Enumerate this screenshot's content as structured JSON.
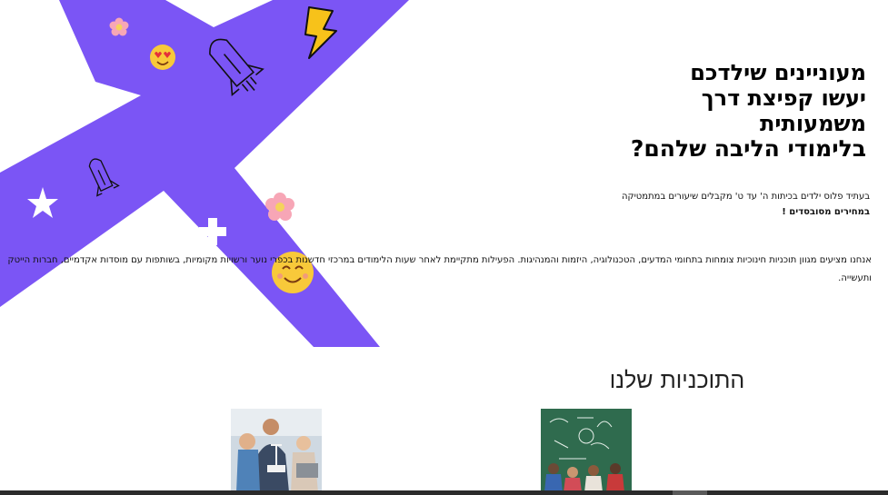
{
  "hero": {
    "headline": [
      "מעוניינים שילדכם",
      "יעשו קפיצת דרך",
      "משמעותית",
      "בלימודי הליבה שלהם?"
    ],
    "intro_text": "בעתיד פלוס ילדים בכיתות ה' עד ט' מקבלים שיעורים במתמטיקה",
    "intro_bold": "במחירים מסובסדים !",
    "description": "אנחנו מציעים מגוון תוכניות חינוכיות צומחות בתחומי המדעים, הטכנולוגיה, היזמות והמנהיגות. הפעילות מתקיימת לאחר שעות הלימודים במרכזי חדשנות בכפרי נוער ורשויות מקומיות, בשותפות עם מוסדות אקדמיים, חברות הייטק ותעשייה."
  },
  "programs": {
    "title": "התוכניות שלנו"
  },
  "colors": {
    "accent": "#7b55f5",
    "lightning": "#f7c21a",
    "emoji": "#f8c93a",
    "flower": "#f7a6b6"
  },
  "icons": [
    "flower-icon",
    "heart-eyes-emoji-icon",
    "rocket-icon",
    "lightning-icon",
    "star-icon",
    "plus-icon",
    "smile-emoji-icon"
  ]
}
